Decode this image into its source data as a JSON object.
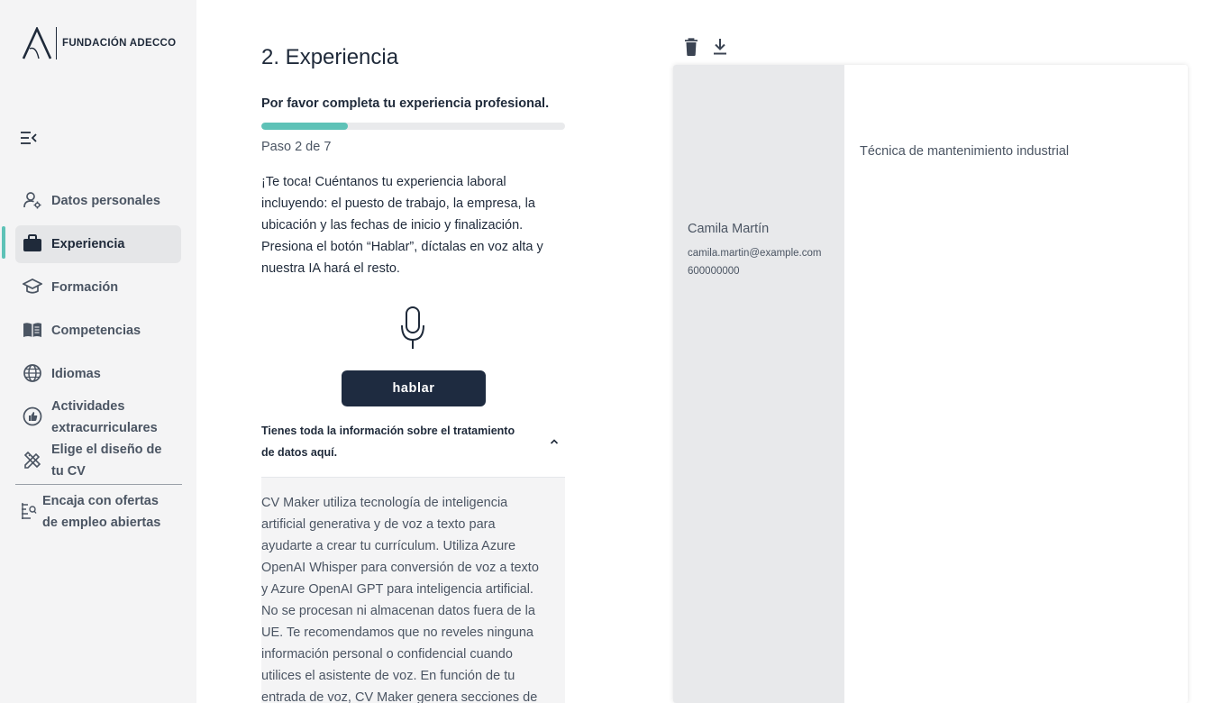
{
  "brand": {
    "name": "FUNDACIÓN ADECCO",
    "accent": "#5ec2b7",
    "dark": "#1e2b40"
  },
  "sidebar": {
    "items": [
      {
        "label": "Datos personales",
        "icon": "user-settings-icon"
      },
      {
        "label": "Experiencia",
        "icon": "briefcase-icon",
        "active": true
      },
      {
        "label": "Formación",
        "icon": "graduation-cap-icon"
      },
      {
        "label": "Competencias",
        "icon": "open-book-icon"
      },
      {
        "label": "Idiomas",
        "icon": "globe-icon"
      },
      {
        "label": "Actividades extracurriculares",
        "icon": "thumbs-up-icon"
      },
      {
        "label": "Elige el diseño de tu CV",
        "icon": "design-tools-icon"
      },
      {
        "label": "Encaja con ofertas de empleo abiertas",
        "icon": "job-match-icon"
      }
    ]
  },
  "main": {
    "title": "2. Experiencia",
    "subtitle": "Por favor completa tu experiencia profesional.",
    "progress": {
      "current": 2,
      "total": 7
    },
    "step_label": "Paso 2 de 7",
    "intro": "¡Te toca! Cuéntanos tu experiencia laboral incluyendo: el puesto de trabajo, la empresa, la ubicación y las fechas de inicio y finalización. Presiona el botón “Hablar”, díctalas en voz alta y nuestra IA hará el resto.",
    "talk_button": "hablar",
    "accordion": {
      "title": "Tienes toda la información sobre el tratamiento de datos aquí.",
      "expanded": true,
      "body": "CV Maker utiliza tecnología de inteligencia artificial generativa y de voz a texto para ayudarte a crear tu currículum. Utiliza Azure OpenAI Whisper para conversión de voz a texto y Azure OpenAI GPT para inteligencia artificial. No se procesan ni almacenan datos fuera de la UE. Te recomendamos que no reveles ninguna información personal o confidencial cuando utilices el asistente de voz. En función de tu entrada de voz, CV Maker genera secciones de"
    }
  },
  "preview": {
    "toolbar": {
      "delete_icon": "trash-icon",
      "download_icon": "download-icon"
    },
    "name": "Camila Martín",
    "email": "camila.martin@example.com",
    "phone": "600000000",
    "role": "Técnica de mantenimiento industrial"
  }
}
